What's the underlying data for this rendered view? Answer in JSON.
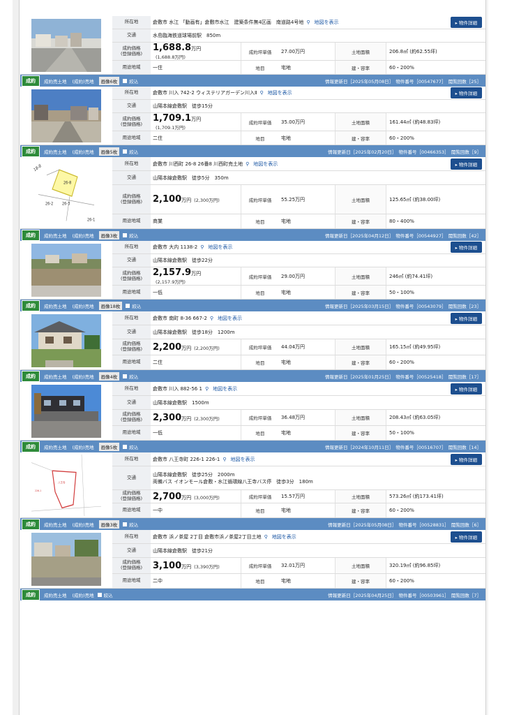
{
  "labels": {
    "address": "所在地",
    "traffic": "交通",
    "price": "成約価格\n(登録価格)",
    "tsubo_price": "成約坪単価",
    "land_area": "土地面積",
    "zoning": "用途地域",
    "chimoku": "地目",
    "ratio": "建・容率",
    "map_link": "地図を表示",
    "detail_button": "物件詳細",
    "status_badge": "成約",
    "category": "成約売土地",
    "category2": "(成約)売地",
    "narrow": "絞込",
    "updated_prefix": "情報更新日",
    "id_prefix": "物件番号",
    "views_prefix": "閲覧回数",
    "yen_man": "万円"
  },
  "listings": [
    {
      "address": "倉敷市 水江 「動画有」倉敷市水江　建築条件無4区画　南道路4号地",
      "traffic": "水島臨海鉄道球場前駅　850m",
      "price_main": "1,688.8",
      "price_reg": "(1,688.8万円)",
      "tsubo": "27.00万円",
      "land": "206.8㎡ (約62.55坪)",
      "zoning": "一住",
      "chimoku": "宅地",
      "ratio": "60・200%",
      "photo": "street-lot-1",
      "bar": {
        "images": "画像6枚",
        "updated": "［2025年05月08日］",
        "id": "［00547677］",
        "views": "［25］"
      }
    },
    {
      "address": "倉敷市 川入 742-2 ウィステリアガーデン川入Ⅱ",
      "traffic": "山陽本線倉敷駅　徒歩15分",
      "price_main": "1,709.1",
      "price_reg": "(1,709.1万円)",
      "tsubo": "35.00万円",
      "land": "161.44㎡ (約48.83坪)",
      "zoning": "二住",
      "chimoku": "宅地",
      "ratio": "60・200%",
      "photo": "street-lot-2",
      "bar": {
        "images": "画像5枚",
        "updated": "［2025年02月20日］",
        "id": "［00466353］",
        "views": "［9］"
      }
    },
    {
      "address": "倉敷市 川西町 26-8 26番8 川西町売土地",
      "traffic": "山陽本線倉敷駅　徒歩5分　350m",
      "price_main": "2,100",
      "price_reg": "(2,300万円)",
      "tsubo": "55.25万円",
      "land": "125.65㎡ (約38.00坪)",
      "zoning": "商業",
      "chimoku": "宅地",
      "ratio": "80・400%",
      "photo": "plot-map",
      "plot_labels": [
        "26-8",
        "26-2",
        "26-3",
        "26-1",
        "18-8"
      ],
      "bar": {
        "images": "画像3枚",
        "updated": "［2025年04月12日］",
        "id": "［00544927］",
        "views": "［42］"
      }
    },
    {
      "address": "倉敷市 大内 1138-2",
      "traffic": "山陽本線倉敷駅　徒歩22分",
      "price_main": "2,157.9",
      "price_reg": "(2,157.9万円)",
      "tsubo": "29.00万円",
      "land": "246㎡ (約74.41坪)",
      "zoning": "一低",
      "chimoku": "宅地",
      "ratio": "50・100%",
      "photo": "field-lot",
      "bar": {
        "images": "画像18枚",
        "updated": "［2025年03月15日］",
        "id": "［00543079］",
        "views": "［23］"
      }
    },
    {
      "address": "倉敷市 南町 8-36 667-2",
      "traffic": "山陽本線倉敷駅　徒歩18分　1200m",
      "price_main": "2,200",
      "price_reg": "(2,200万円)",
      "tsubo": "44.04万円",
      "land": "165.15㎡ (約49.95坪)",
      "zoning": "二住",
      "chimoku": "宅地",
      "ratio": "60・200%",
      "photo": "old-house",
      "bar": {
        "images": "画像4枚",
        "updated": "［2025年01月25日］",
        "id": "［00525418］",
        "views": "［17］"
      }
    },
    {
      "address": "倉敷市 川入 882-56 1",
      "traffic": "山陽本線倉敷駅　1500m",
      "price_main": "2,300",
      "price_reg": "(2,300万円)",
      "tsubo": "36.48万円",
      "land": "208.43㎡ (約63.05坪)",
      "zoning": "一低",
      "chimoku": "宅地",
      "ratio": "50・100%",
      "photo": "house-garage",
      "bar": {
        "images": "画像5枚",
        "updated": "［2024年10月11日］",
        "id": "［00516707］",
        "views": "［14］"
      }
    },
    {
      "address": "倉敷市 八王寺町 226-1 226-1",
      "traffic": "山陽本線倉敷駅　徒歩25分　2000m",
      "traffic2": "両備バス イオンモール倉敷・水江循環線八王寺バス停　徒歩3分　180m",
      "price_main": "2,700",
      "price_reg": "(3,000万円)",
      "tsubo": "15.57万円",
      "land": "573.26㎡ (約173.41坪)",
      "zoning": "一中",
      "chimoku": "宅地",
      "ratio": "60・200%",
      "photo": "site-plan",
      "bar": {
        "images": "画像3枚",
        "updated": "［2025年05月08日］",
        "id": "［00528831］",
        "views": "［6］"
      }
    },
    {
      "address": "倉敷市 浜ノ茶屋 2丁目 倉敷市浜ノ茶屋2丁目土地",
      "traffic": "山陽本線倉敷駅　徒歩21分",
      "price_main": "3,100",
      "price_reg": "(3,390万円)",
      "tsubo": "32.01万円",
      "land": "320.19㎡ (約96.85坪)",
      "zoning": "二中",
      "chimoku": "宅地",
      "ratio": "60・200%",
      "photo": "residential-lot",
      "bar": {
        "images": "",
        "updated": "［2025年04月25日］",
        "id": "［00503961］",
        "views": "［7］"
      }
    }
  ]
}
